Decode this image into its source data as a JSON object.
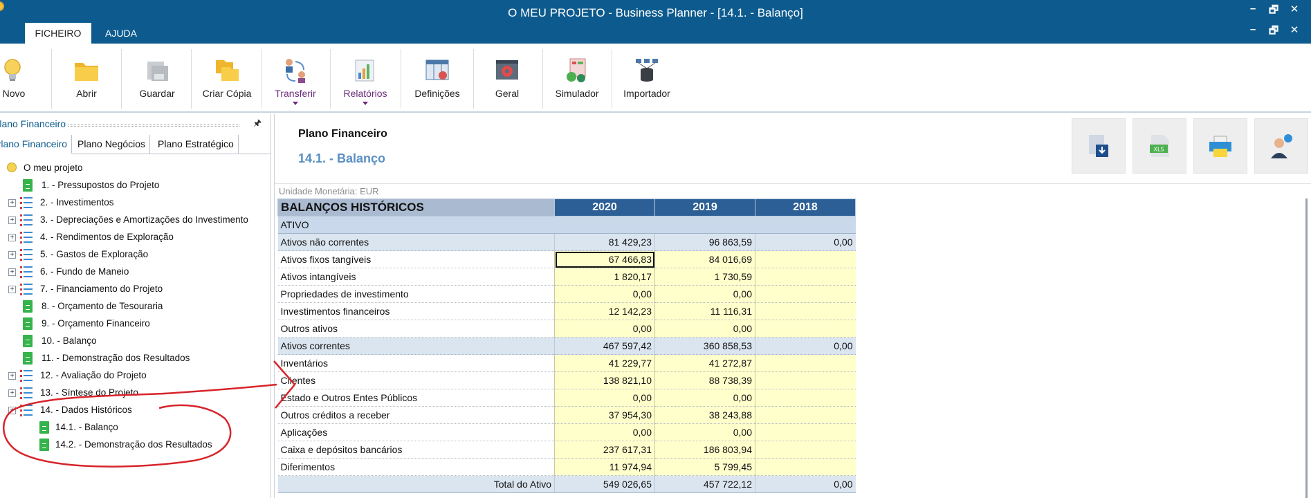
{
  "window": {
    "title": "O MEU PROJETO - Business Planner - [14.1. - Balanço]",
    "controls": [
      "–",
      "🗗",
      "✕"
    ]
  },
  "ribbon_tabs": [
    {
      "label": "FICHEIRO"
    },
    {
      "label": "AJUDA"
    }
  ],
  "toolbar": [
    {
      "label": "Novo",
      "icon": "lightbulb-icon"
    },
    {
      "label": "Abrir",
      "icon": "folder-icon"
    },
    {
      "label": "Guardar",
      "icon": "save-icon"
    },
    {
      "label": "Criar Cópia",
      "icon": "copy-icon"
    },
    {
      "label": "Transferir",
      "icon": "transfer-icon",
      "dropdown": true
    },
    {
      "label": "Relatórios",
      "icon": "reports-icon",
      "dropdown": true
    },
    {
      "label": "Definições",
      "icon": "settings-table-icon"
    },
    {
      "label": "Geral",
      "icon": "gear-window-icon"
    },
    {
      "label": "Simulador",
      "icon": "simulator-icon"
    },
    {
      "label": "Importador",
      "icon": "importer-icon"
    }
  ],
  "left_panel": {
    "title": "Plano Financeiro",
    "tabs": [
      "Plano Financeiro",
      "Plano Negócios",
      "Plano Estratégico"
    ],
    "tree": [
      {
        "label": "O meu projeto",
        "type": "root"
      },
      {
        "label": "1. - Pressupostos do Projeto",
        "type": "leaf"
      },
      {
        "label": "2. - Investimentos",
        "type": "group"
      },
      {
        "label": "3. - Depreciações e Amortizações do Investimento",
        "type": "group"
      },
      {
        "label": "4. - Rendimentos de Exploração",
        "type": "group"
      },
      {
        "label": "5. - Gastos de Exploração",
        "type": "group"
      },
      {
        "label": "6. - Fundo de Maneio",
        "type": "group"
      },
      {
        "label": "7. - Financiamento do Projeto",
        "type": "group"
      },
      {
        "label": "8. - Orçamento de Tesouraria",
        "type": "leaf"
      },
      {
        "label": "9. - Orçamento Financeiro",
        "type": "leaf"
      },
      {
        "label": "10. - Balanço",
        "type": "leaf"
      },
      {
        "label": "11. - Demonstração dos Resultados",
        "type": "leaf"
      },
      {
        "label": "12. - Avaliação do Projeto",
        "type": "group"
      },
      {
        "label": "13. - Síntese do Projeto",
        "type": "group"
      },
      {
        "label": "14. - Dados Históricos",
        "type": "group"
      },
      {
        "label": "14.1. - Balanço",
        "type": "subleaf"
      },
      {
        "label": "14.2. - Demonstração dos Resultados",
        "type": "subleaf"
      }
    ]
  },
  "main": {
    "title": "Plano Financeiro",
    "subtitle": "14.1. - Balanço",
    "currency": "Unidade Monetária: EUR",
    "actions": [
      "export-icon",
      "xls-icon",
      "print-icon",
      "help-icon"
    ],
    "xls_badge": "XLS",
    "table": {
      "header": [
        "BALANÇOS HISTÓRICOS",
        "2020",
        "2019",
        "2018"
      ],
      "rows": [
        {
          "kind": "section",
          "label": "ATIVO",
          "values": [
            "",
            "",
            ""
          ]
        },
        {
          "kind": "group",
          "label": "Ativos não correntes",
          "values": [
            "81 429,23",
            "96 863,59",
            "0,00"
          ]
        },
        {
          "kind": "item",
          "label": "Ativos fixos tangíveis",
          "values": [
            "67 466,83",
            "84 016,69",
            ""
          ]
        },
        {
          "kind": "item",
          "label": "Ativos intangíveis",
          "values": [
            "1 820,17",
            "1 730,59",
            ""
          ]
        },
        {
          "kind": "item",
          "label": "Propriedades de investimento",
          "values": [
            "0,00",
            "0,00",
            ""
          ]
        },
        {
          "kind": "item",
          "label": "Investimentos financeiros",
          "values": [
            "12 142,23",
            "11 116,31",
            ""
          ]
        },
        {
          "kind": "item",
          "label": "Outros ativos",
          "values": [
            "0,00",
            "0,00",
            ""
          ]
        },
        {
          "kind": "group",
          "label": "Ativos correntes",
          "values": [
            "467 597,42",
            "360 858,53",
            "0,00"
          ]
        },
        {
          "kind": "item2",
          "label": "Inventários",
          "values": [
            "41 229,77",
            "41 272,87",
            ""
          ]
        },
        {
          "kind": "item2",
          "label": "Clientes",
          "values": [
            "138 821,10",
            "88 738,39",
            ""
          ]
        },
        {
          "kind": "item2",
          "label": "Estado e Outros Entes Públicos",
          "values": [
            "0,00",
            "0,00",
            ""
          ]
        },
        {
          "kind": "item2",
          "label": "Outros créditos a receber",
          "values": [
            "37 954,30",
            "38 243,88",
            ""
          ]
        },
        {
          "kind": "item2",
          "label": "Aplicações",
          "values": [
            "0,00",
            "0,00",
            ""
          ]
        },
        {
          "kind": "item2",
          "label": "Caixa e depósitos bancários",
          "values": [
            "237 617,31",
            "186 803,94",
            ""
          ]
        },
        {
          "kind": "item2",
          "label": "Diferimentos",
          "values": [
            "11 974,94",
            "5 799,45",
            ""
          ]
        },
        {
          "kind": "total",
          "label": "Total do Ativo",
          "values": [
            "549 026,65",
            "457 722,12",
            "0,00"
          ]
        }
      ]
    }
  }
}
